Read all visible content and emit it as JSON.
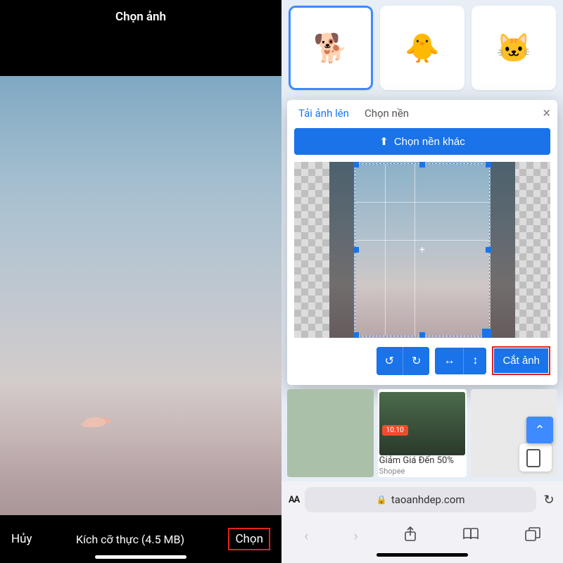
{
  "left": {
    "title": "Chọn ảnh",
    "cancel": "Hủy",
    "size_info": "Kích cỡ thực (4.5 MB)",
    "choose": "Chọn"
  },
  "right": {
    "tabs": {
      "upload": "Tải ảnh lên",
      "background": "Chọn nền"
    },
    "close": "×",
    "choose_other_bg": "Chọn nền khác",
    "toolbar": {
      "undo": "↺",
      "redo": "↻",
      "flip_h": "↔",
      "flip_v": "↕",
      "crop": "Cắt ảnh"
    },
    "ad": {
      "badge": "10.10",
      "title": "Giảm Giá Đến 50%",
      "sub": "Shopee"
    },
    "scroll_top": "⌃",
    "safari": {
      "aa": "AA",
      "lock": "🔒",
      "domain": "taoanhdep.com",
      "reload": "↻",
      "back": "‹",
      "fwd": "›",
      "share": "↥",
      "bookmarks": "▭▭",
      "tabs": "⧉"
    }
  }
}
